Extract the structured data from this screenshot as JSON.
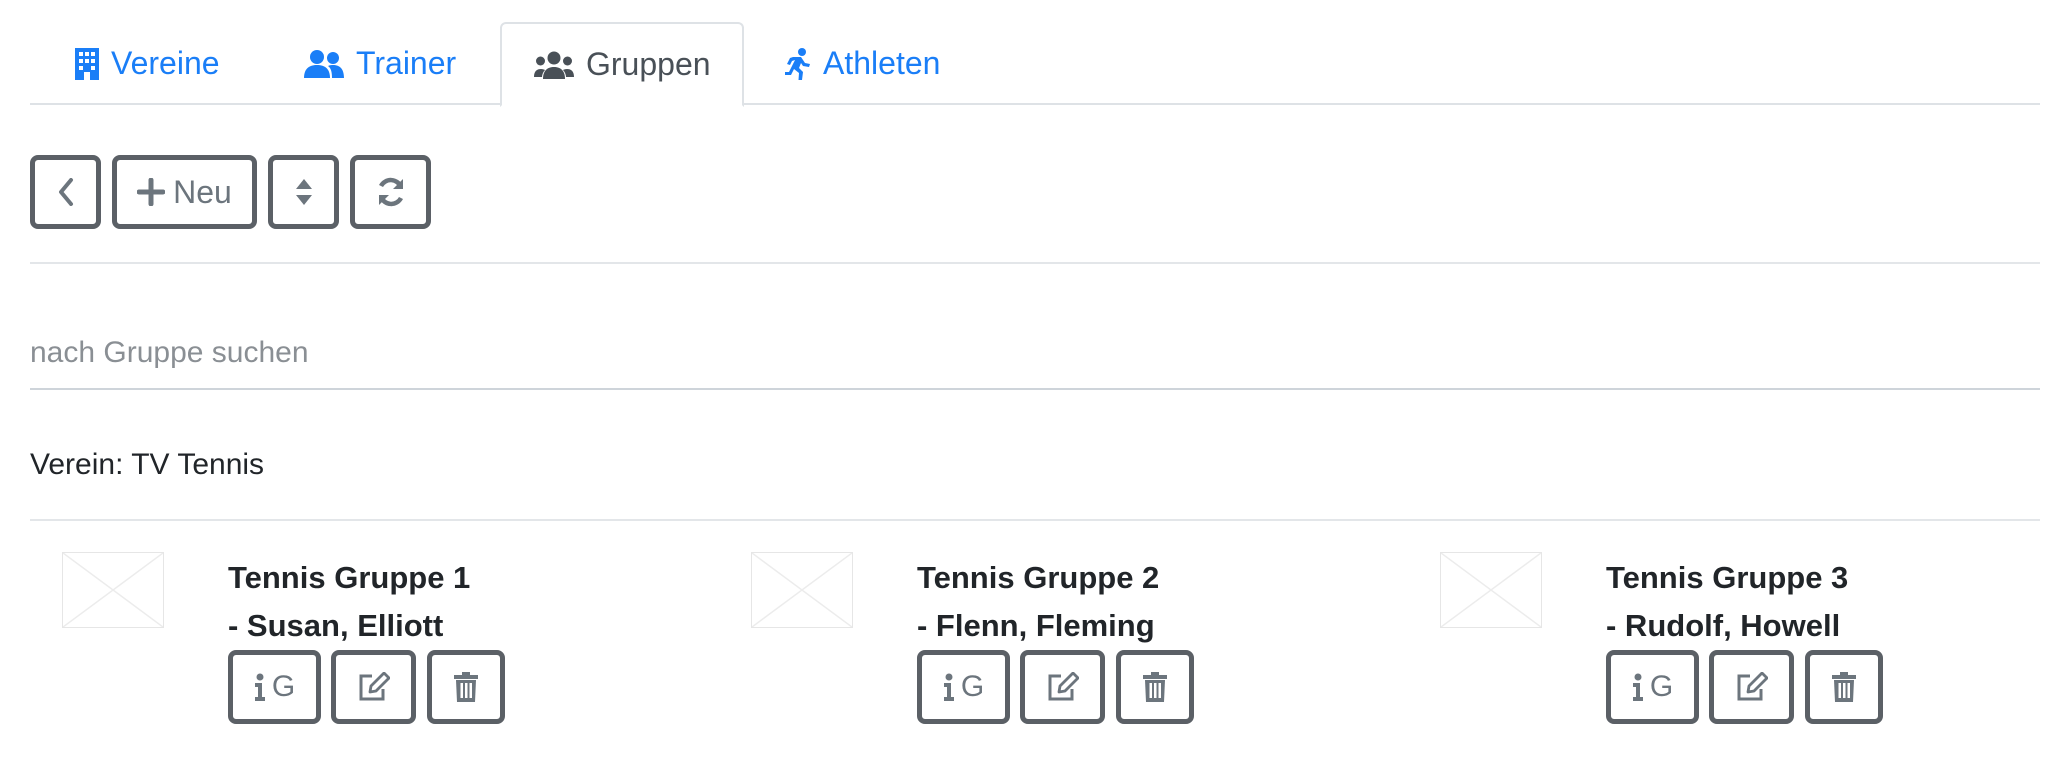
{
  "tabs": [
    {
      "label": "Vereine",
      "icon": "building-icon",
      "active": false
    },
    {
      "label": "Trainer",
      "icon": "users-icon",
      "active": false
    },
    {
      "label": "Gruppen",
      "icon": "user-group-icon",
      "active": true
    },
    {
      "label": "Athleten",
      "icon": "running-icon",
      "active": false
    }
  ],
  "toolbar": {
    "back_icon": "chevron-left-icon",
    "new_label": "Neu",
    "sort_icon": "sort-icon",
    "refresh_icon": "refresh-icon"
  },
  "search": {
    "value": "",
    "placeholder": "nach Gruppe suchen"
  },
  "verein": {
    "label": "Verein: TV Tennis"
  },
  "groups": [
    {
      "name": "Tennis Gruppe 1",
      "trainer": "- Susan, Elliott",
      "info_label": "G"
    },
    {
      "name": "Tennis Gruppe 2",
      "trainer": "- Flenn, Fleming",
      "info_label": "G"
    },
    {
      "name": "Tennis Gruppe 3",
      "trainer": "- Rudolf, Howell",
      "info_label": "G"
    }
  ],
  "colors": {
    "link": "#1a7ef7",
    "active_tab_text": "#495057",
    "button_border": "#5b6066",
    "button_icon": "#6c757d"
  }
}
